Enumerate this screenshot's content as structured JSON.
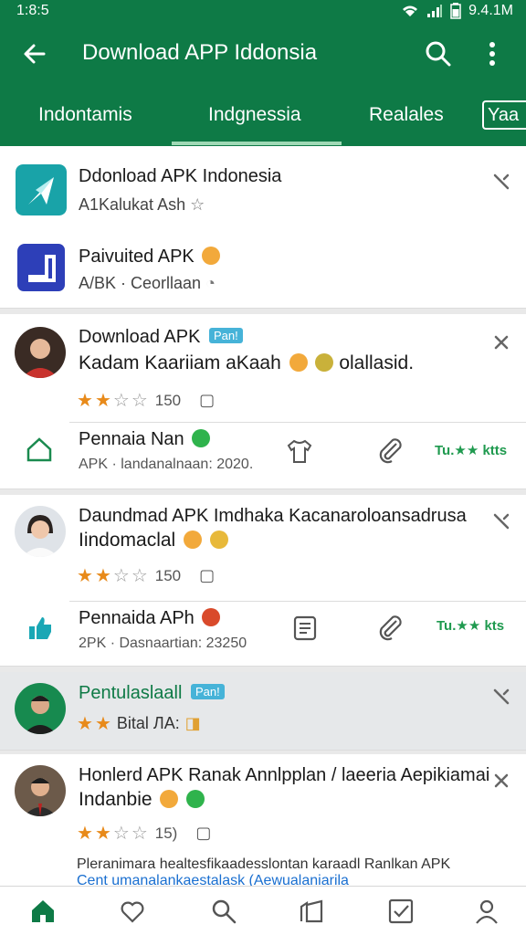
{
  "status": {
    "time": "1:8:5",
    "right_text": "9.4.1M"
  },
  "appbar": {
    "title": "Download APP Iddonsia"
  },
  "tabs": [
    {
      "label": "Indontamis"
    },
    {
      "label": "Indgnessia"
    },
    {
      "label": "Realales"
    },
    {
      "label": "Yaa"
    }
  ],
  "cards": {
    "c1": {
      "apps": [
        {
          "title": "Ddonload APK Indonesia",
          "subtitle": "A1Kalukat Ash"
        },
        {
          "title": "Paivuited APK",
          "subtitle": "A/ΒK · Ceorllaan"
        }
      ]
    },
    "c2": {
      "title": "Download APK",
      "badge": "Pan!",
      "text": "Kadam Kaariiam aKaah",
      "text_tail": "olallasid.",
      "rating_count": "150",
      "sub_title": "Pennaia Nan",
      "sub_meta": "APK · landanalnaan: 2020.",
      "rate_label": "Tu.★★ ktts"
    },
    "c3": {
      "title": "Daundmad APK Imdhaka Kacanaroloansadrusa",
      "title2": "Iindomaclal",
      "rating_count": "150",
      "sub_title": "Pennaida APh",
      "sub_meta": "2PK · Dasnaartian: 23250",
      "rate_label": "Tu.★★ kts"
    },
    "c4": {
      "title": "Pentulaslaall",
      "badge": "Pan!",
      "rating_text": "Bital ЛА:"
    },
    "c5": {
      "title": "Honlerd APK Ranak Annlpplan / laeeria Aepikiamai",
      "title2": "Indanbie",
      "rating_count": "15)",
      "foot1": "Pleranimara healtesfikaadesslontan karaadl Ranlkan APK",
      "foot2": "Cent umanalankaestalask (Aewualaniarila"
    }
  },
  "colors": {
    "brand": "#0e7a46",
    "star": "#e88a1a",
    "badge": "#46b3d8"
  }
}
